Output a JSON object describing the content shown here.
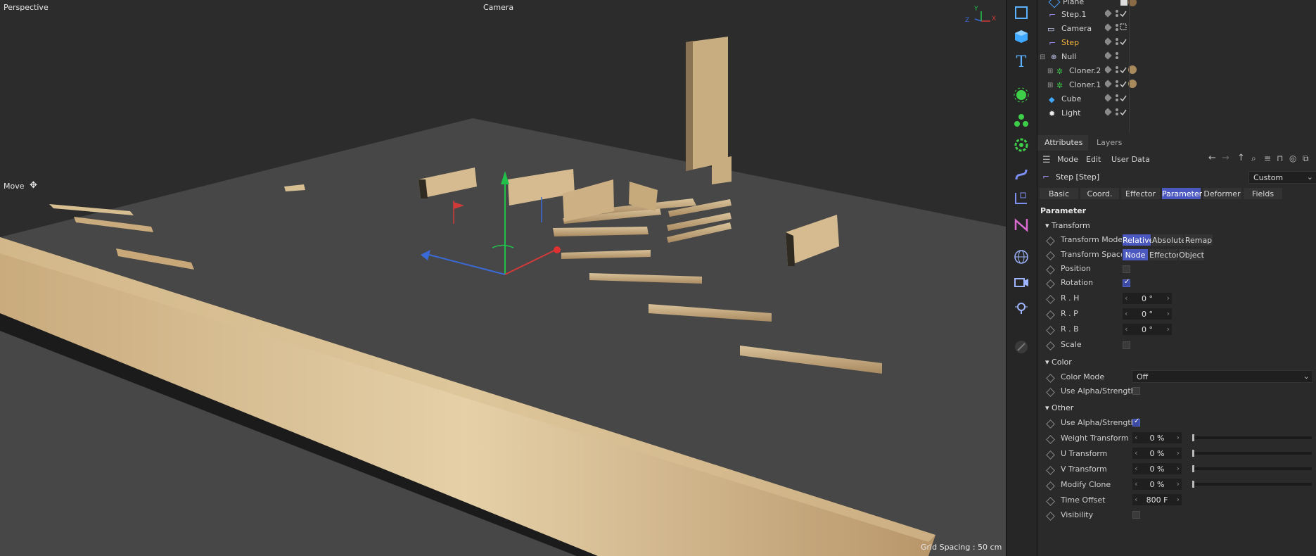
{
  "viewport": {
    "view_name": "Perspective",
    "camera_label": "Camera",
    "tool_label": "Move",
    "grid_spacing": "Grid Spacing : 50 cm",
    "axis_x": "X",
    "axis_y": "Y",
    "axis_z": "Z"
  },
  "object_manager": {
    "objects": [
      {
        "name": "Plane",
        "icon": "plane-icon"
      },
      {
        "name": "Step.1",
        "icon": "step-effector-icon"
      },
      {
        "name": "Camera",
        "icon": "camera-icon"
      },
      {
        "name": "Step",
        "icon": "step-effector-icon",
        "active": true
      },
      {
        "name": "Null",
        "icon": "null-icon"
      },
      {
        "name": "Cloner.2",
        "icon": "cloner-icon"
      },
      {
        "name": "Cloner.1",
        "icon": "cloner-icon"
      },
      {
        "name": "Cube",
        "icon": "cube-icon"
      },
      {
        "name": "Light",
        "icon": "light-icon"
      }
    ]
  },
  "attributes": {
    "tabs": [
      "Attributes",
      "Layers"
    ],
    "menu": [
      "Mode",
      "Edit",
      "User Data"
    ],
    "object_title": "Step [Step]",
    "preset": "Custom",
    "subtabs": [
      "Basic",
      "Coord.",
      "Effector",
      "Parameter",
      "Deformer",
      "Fields"
    ],
    "active_subtab": "Parameter",
    "group_title": "Parameter",
    "transform": {
      "title": "Transform",
      "mode_label": "Transform Mode",
      "mode_options": [
        "Relative",
        "Absolute",
        "Remap"
      ],
      "space_label": "Transform Space",
      "space_options": [
        "Node",
        "Effector",
        "Object"
      ],
      "position_label": "Position",
      "position_checked": false,
      "rotation_label": "Rotation",
      "rotation_checked": true,
      "rh_label": "R . H",
      "rh_value": "0 °",
      "rp_label": "R . P",
      "rp_value": "0 °",
      "rb_label": "R . B",
      "rb_value": "0 °",
      "scale_label": "Scale",
      "scale_checked": false
    },
    "color": {
      "title": "Color",
      "mode_label": "Color Mode",
      "mode_value": "Off",
      "alpha_label": "Use Alpha/Strength",
      "alpha_checked": false
    },
    "other": {
      "title": "Other",
      "alpha_label": "Use Alpha/Strength",
      "alpha_checked": true,
      "weight_label": "Weight Transform",
      "weight_value": "0 %",
      "u_label": "U Transform",
      "u_value": "0 %",
      "v_label": "V Transform",
      "v_value": "0 %",
      "modify_label": "Modify Clone",
      "modify_value": "0 %",
      "time_label": "Time Offset",
      "time_value": "800 F",
      "visibility_label": "Visibility",
      "visibility_checked": false
    }
  },
  "colors": {
    "accent": "#4b58c0",
    "active_object": "#f2b23c",
    "viewport_bg": "#2c2c2c",
    "floor": "#4a4a4a"
  }
}
